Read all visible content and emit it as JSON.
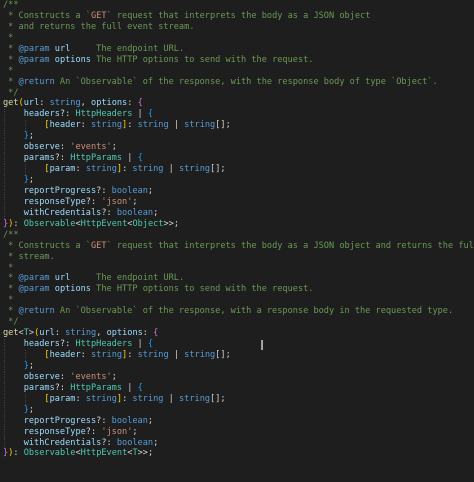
{
  "editor": {
    "language": "typescript",
    "theme_colors": {
      "background": "#1e1e1e",
      "comment": "#6a9955",
      "keyword": "#569cd6",
      "type": "#4ec9b0",
      "function": "#dcdcaa",
      "property": "#9cdcfe",
      "string": "#ce9178",
      "plain": "#d4d4d4"
    },
    "lines": [
      {
        "indent": 0,
        "tokens": [
          [
            "comment",
            "/**"
          ]
        ]
      },
      {
        "indent": 0,
        "tokens": [
          [
            "comment",
            " * Constructs a `"
          ],
          [
            "code",
            "GET"
          ],
          [
            "comment",
            "` request that interprets the body as a JSON object"
          ]
        ]
      },
      {
        "indent": 0,
        "tokens": [
          [
            "comment",
            " * and returns the full event stream."
          ]
        ]
      },
      {
        "indent": 0,
        "tokens": [
          [
            "comment",
            " *"
          ]
        ]
      },
      {
        "indent": 0,
        "tokens": [
          [
            "comment",
            " * "
          ],
          [
            "tag",
            "@param"
          ],
          [
            "comment",
            " "
          ],
          [
            "prop",
            "url"
          ],
          [
            "comment",
            "     The endpoint URL."
          ]
        ]
      },
      {
        "indent": 0,
        "tokens": [
          [
            "comment",
            " * "
          ],
          [
            "tag",
            "@param"
          ],
          [
            "comment",
            " "
          ],
          [
            "prop",
            "options"
          ],
          [
            "comment",
            " The HTTP options to send with the request."
          ]
        ]
      },
      {
        "indent": 0,
        "tokens": [
          [
            "comment",
            " *"
          ]
        ]
      },
      {
        "indent": 0,
        "tokens": [
          [
            "comment",
            " * "
          ],
          [
            "tag",
            "@return"
          ],
          [
            "comment",
            " An `Observable` of the response, with the response body of type `Object`."
          ]
        ]
      },
      {
        "indent": 0,
        "tokens": [
          [
            "comment",
            " */"
          ]
        ]
      },
      {
        "indent": 0,
        "tokens": [
          [
            "func",
            "get"
          ],
          [
            "bracket",
            "("
          ],
          [
            "prop",
            "url"
          ],
          [
            "plain",
            ": "
          ],
          [
            "kw",
            "string"
          ],
          [
            "plain",
            ", "
          ],
          [
            "prop",
            "options"
          ],
          [
            "plain",
            ": "
          ],
          [
            "bracket2",
            "{"
          ]
        ]
      },
      {
        "indent": 1,
        "tokens": [
          [
            "prop",
            "headers"
          ],
          [
            "plain",
            "?: "
          ],
          [
            "type",
            "HttpHeaders"
          ],
          [
            "plain",
            " | "
          ],
          [
            "bracket3",
            "{"
          ]
        ]
      },
      {
        "indent": 2,
        "tokens": [
          [
            "bracket",
            "["
          ],
          [
            "prop",
            "header"
          ],
          [
            "plain",
            ": "
          ],
          [
            "kw",
            "string"
          ],
          [
            "bracket",
            "]"
          ],
          [
            "plain",
            ": "
          ],
          [
            "kw",
            "string"
          ],
          [
            "plain",
            " | "
          ],
          [
            "kw",
            "string"
          ],
          [
            "plain",
            "[];"
          ]
        ]
      },
      {
        "indent": 1,
        "tokens": [
          [
            "bracket3",
            "}"
          ],
          [
            "plain",
            ";"
          ]
        ]
      },
      {
        "indent": 1,
        "tokens": [
          [
            "prop",
            "observe"
          ],
          [
            "plain",
            ": "
          ],
          [
            "str",
            "'events'"
          ],
          [
            "plain",
            ";"
          ]
        ]
      },
      {
        "indent": 1,
        "tokens": [
          [
            "prop",
            "params"
          ],
          [
            "plain",
            "?: "
          ],
          [
            "type",
            "HttpParams"
          ],
          [
            "plain",
            " | "
          ],
          [
            "bracket3",
            "{"
          ]
        ]
      },
      {
        "indent": 2,
        "tokens": [
          [
            "bracket",
            "["
          ],
          [
            "prop",
            "param"
          ],
          [
            "plain",
            ": "
          ],
          [
            "kw",
            "string"
          ],
          [
            "bracket",
            "]"
          ],
          [
            "plain",
            ": "
          ],
          [
            "kw",
            "string"
          ],
          [
            "plain",
            " | "
          ],
          [
            "kw",
            "string"
          ],
          [
            "plain",
            "[];"
          ]
        ]
      },
      {
        "indent": 1,
        "tokens": [
          [
            "bracket3",
            "}"
          ],
          [
            "plain",
            ";"
          ]
        ]
      },
      {
        "indent": 1,
        "tokens": [
          [
            "prop",
            "reportProgress"
          ],
          [
            "plain",
            "?: "
          ],
          [
            "kw",
            "boolean"
          ],
          [
            "plain",
            ";"
          ]
        ]
      },
      {
        "indent": 1,
        "tokens": [
          [
            "prop",
            "responseType"
          ],
          [
            "plain",
            "?: "
          ],
          [
            "str",
            "'json'"
          ],
          [
            "plain",
            ";"
          ]
        ]
      },
      {
        "indent": 1,
        "tokens": [
          [
            "prop",
            "withCredentials"
          ],
          [
            "plain",
            "?: "
          ],
          [
            "kw",
            "boolean"
          ],
          [
            "plain",
            ";"
          ]
        ]
      },
      {
        "indent": 0,
        "tokens": [
          [
            "bracket2",
            "}"
          ],
          [
            "bracket",
            ")"
          ],
          [
            "plain",
            ": "
          ],
          [
            "type",
            "Observable"
          ],
          [
            "plain",
            "<"
          ],
          [
            "type",
            "HttpEvent"
          ],
          [
            "plain",
            "<"
          ],
          [
            "type",
            "Object"
          ],
          [
            "plain",
            ">>;"
          ]
        ]
      },
      {
        "indent": 0,
        "tokens": [
          [
            "comment",
            "/**"
          ]
        ]
      },
      {
        "indent": 0,
        "tokens": [
          [
            "comment",
            " * Constructs a `"
          ],
          [
            "code",
            "GET"
          ],
          [
            "comment",
            "` request that interprets the body as a JSON object and returns the full event"
          ]
        ]
      },
      {
        "indent": 0,
        "tokens": [
          [
            "comment",
            " * stream."
          ]
        ]
      },
      {
        "indent": 0,
        "tokens": [
          [
            "comment",
            " *"
          ]
        ]
      },
      {
        "indent": 0,
        "tokens": [
          [
            "comment",
            " * "
          ],
          [
            "tag",
            "@param"
          ],
          [
            "comment",
            " "
          ],
          [
            "prop",
            "url"
          ],
          [
            "comment",
            "     The endpoint URL."
          ]
        ]
      },
      {
        "indent": 0,
        "tokens": [
          [
            "comment",
            " * "
          ],
          [
            "tag",
            "@param"
          ],
          [
            "comment",
            " "
          ],
          [
            "prop",
            "options"
          ],
          [
            "comment",
            " The HTTP options to send with the request."
          ]
        ]
      },
      {
        "indent": 0,
        "tokens": [
          [
            "comment",
            " *"
          ]
        ]
      },
      {
        "indent": 0,
        "tokens": [
          [
            "comment",
            " * "
          ],
          [
            "tag",
            "@return"
          ],
          [
            "comment",
            " An `Observable` of the response, with a response body in the requested type."
          ]
        ]
      },
      {
        "indent": 0,
        "tokens": [
          [
            "comment",
            " */"
          ]
        ]
      },
      {
        "indent": 0,
        "tokens": [
          [
            "func",
            "get"
          ],
          [
            "plain",
            "<"
          ],
          [
            "type",
            "T"
          ],
          [
            "plain",
            ">"
          ],
          [
            "bracket",
            "("
          ],
          [
            "prop",
            "url"
          ],
          [
            "plain",
            ": "
          ],
          [
            "kw",
            "string"
          ],
          [
            "plain",
            ", "
          ],
          [
            "prop",
            "options"
          ],
          [
            "plain",
            ": "
          ],
          [
            "bracket2",
            "{"
          ]
        ]
      },
      {
        "indent": 1,
        "tokens": [
          [
            "prop",
            "headers"
          ],
          [
            "plain",
            "?: "
          ],
          [
            "type",
            "HttpHeaders"
          ],
          [
            "plain",
            " | "
          ],
          [
            "bracket3",
            "{"
          ]
        ]
      },
      {
        "indent": 2,
        "tokens": [
          [
            "bracket",
            "["
          ],
          [
            "prop",
            "header"
          ],
          [
            "plain",
            ": "
          ],
          [
            "kw",
            "string"
          ],
          [
            "bracket",
            "]"
          ],
          [
            "plain",
            ": "
          ],
          [
            "kw",
            "string"
          ],
          [
            "plain",
            " | "
          ],
          [
            "kw",
            "string"
          ],
          [
            "plain",
            "[];"
          ]
        ]
      },
      {
        "indent": 1,
        "tokens": [
          [
            "bracket3",
            "}"
          ],
          [
            "plain",
            ";"
          ]
        ]
      },
      {
        "indent": 1,
        "tokens": [
          [
            "prop",
            "observe"
          ],
          [
            "plain",
            ": "
          ],
          [
            "str",
            "'events'"
          ],
          [
            "plain",
            ";"
          ]
        ]
      },
      {
        "indent": 1,
        "tokens": [
          [
            "prop",
            "params"
          ],
          [
            "plain",
            "?: "
          ],
          [
            "type",
            "HttpParams"
          ],
          [
            "plain",
            " | "
          ],
          [
            "bracket3",
            "{"
          ]
        ]
      },
      {
        "indent": 2,
        "tokens": [
          [
            "bracket",
            "["
          ],
          [
            "prop",
            "param"
          ],
          [
            "plain",
            ": "
          ],
          [
            "kw",
            "string"
          ],
          [
            "bracket",
            "]"
          ],
          [
            "plain",
            ": "
          ],
          [
            "kw",
            "string"
          ],
          [
            "plain",
            " | "
          ],
          [
            "kw",
            "string"
          ],
          [
            "plain",
            "[];"
          ]
        ]
      },
      {
        "indent": 1,
        "tokens": [
          [
            "bracket3",
            "}"
          ],
          [
            "plain",
            ";"
          ]
        ]
      },
      {
        "indent": 1,
        "tokens": [
          [
            "prop",
            "reportProgress"
          ],
          [
            "plain",
            "?: "
          ],
          [
            "kw",
            "boolean"
          ],
          [
            "plain",
            ";"
          ]
        ]
      },
      {
        "indent": 1,
        "tokens": [
          [
            "prop",
            "responseType"
          ],
          [
            "plain",
            "?: "
          ],
          [
            "str",
            "'json'"
          ],
          [
            "plain",
            ";"
          ]
        ]
      },
      {
        "indent": 1,
        "tokens": [
          [
            "prop",
            "withCredentials"
          ],
          [
            "plain",
            "?: "
          ],
          [
            "kw",
            "boolean"
          ],
          [
            "plain",
            ";"
          ]
        ]
      },
      {
        "indent": 0,
        "tokens": [
          [
            "bracket2",
            "}"
          ],
          [
            "bracket",
            ")"
          ],
          [
            "plain",
            ": "
          ],
          [
            "type",
            "Observable"
          ],
          [
            "plain",
            "<"
          ],
          [
            "type",
            "HttpEvent"
          ],
          [
            "plain",
            "<"
          ],
          [
            "type",
            "T"
          ],
          [
            "plain",
            ">>;"
          ]
        ]
      }
    ]
  }
}
